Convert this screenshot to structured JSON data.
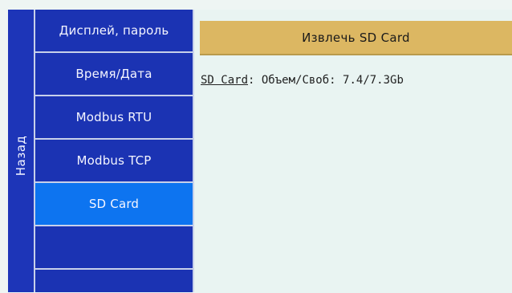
{
  "sidebar": {
    "back_label": "Назад",
    "items": [
      {
        "label": "Дисплей, пароль"
      },
      {
        "label": "Время/Дата"
      },
      {
        "label": "Modbus RTU"
      },
      {
        "label": "Modbus TCP"
      },
      {
        "label": "SD Card",
        "active": true
      },
      {
        "label": ""
      }
    ]
  },
  "main": {
    "eject_button_label": "Извлечь SD Card",
    "sd_info": {
      "link_label": "SD Card",
      "separator": ":",
      "capacity_text": " Объем/Своб: 7.4/7.3Gb"
    }
  },
  "colors": {
    "menu_bg": "#1b33b3",
    "menu_active": "#0d74f0",
    "button_bg": "#dcb762",
    "content_bg": "#e9f4f2"
  }
}
